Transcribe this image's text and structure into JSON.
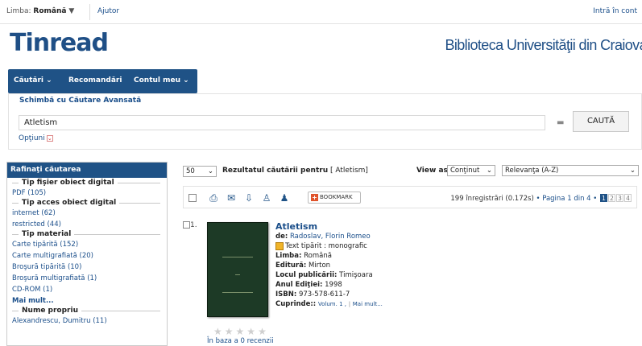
{
  "topbar": {
    "lang_label": "Limba:",
    "lang_value": "Română",
    "lang_caret": "▼",
    "help": "Ajutor",
    "login": "Intră în cont"
  },
  "header": {
    "logo": "Tinread",
    "library": "Biblioteca Universităţii din Craiova"
  },
  "nav": {
    "items": [
      "Căutări",
      "Recomandări",
      "Contul meu"
    ]
  },
  "search": {
    "switch_label": "Schimbă cu  Căutare Avansată",
    "query": "Atletism",
    "button": "CAUTĂ",
    "options": "Opţiuni"
  },
  "refine": {
    "title": "Rafinaţi căutarea",
    "groups": [
      {
        "title": "Tip fişier obiect digital",
        "items": [
          "PDF (105)"
        ]
      },
      {
        "title": "Tip acces obiect digital",
        "items": [
          "internet (62)",
          "restricted (44)"
        ]
      },
      {
        "title": "Tip material",
        "items": [
          "Carte tipărită (152)",
          "Carte multigrafiată (20)",
          "Broşură tipărită (10)",
          "Broşură multigrafiată (1)",
          "CD-ROM (1)"
        ],
        "more": "Mai mult..."
      },
      {
        "title": "Nume propriu",
        "items": [
          "Alexandrescu, Dumitru (11)"
        ]
      }
    ]
  },
  "results": {
    "per_page": "50",
    "label": "Rezultatul căutării pentru",
    "term": "[ Atletism]",
    "view_as_label": "View as",
    "view_as_value": "Conţinut",
    "sort_value": "Relevanţa (A-Z)",
    "bookmark": "BOOKMARK",
    "count_text": "199 înregistrări (0.172s)",
    "page_text": "Pagina 1 din 4",
    "pages": [
      "1",
      "2",
      "3",
      "4"
    ],
    "record": {
      "number": "1.",
      "title": "Atletism",
      "author_label": "de:",
      "author": "Radoslav, Florin Romeo",
      "type": "Text tipărit : monografic",
      "language_label": "Limba:",
      "language": "Română",
      "publisher_label": "Editură:",
      "publisher": "Mirton",
      "place_label": "Locul publicării:",
      "place": "Timişoara",
      "year_label": "Anul Ediţiei:",
      "year": "1998",
      "isbn_label": "ISBN:",
      "isbn": "973-578-611-7",
      "contents_label": "Cuprinde::",
      "contents": "Volum. 1 ,",
      "contents_more": "Mai mult...",
      "rating": 0,
      "reviews": "În baza a 0 recenzii"
    }
  }
}
